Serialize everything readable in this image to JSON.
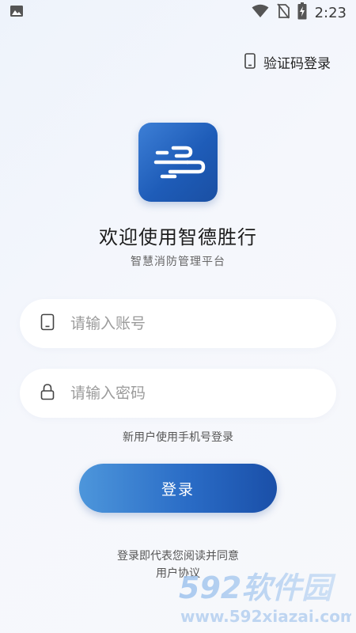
{
  "status_bar": {
    "time": "2:23",
    "icons": [
      "image-icon",
      "wifi-icon",
      "no-sim-icon",
      "battery-charging-icon"
    ]
  },
  "header": {
    "verify_login_label": "验证码登录",
    "verify_login_icon": "phone-icon"
  },
  "app": {
    "title": "欢迎使用智德胜行",
    "subtitle": "智慧消防管理平台",
    "logo_icon": "app-logo-icon",
    "brand_color": "#2a6cc6"
  },
  "form": {
    "account_placeholder": "请输入账号",
    "account_icon": "phone-icon",
    "password_placeholder": "请输入密码",
    "password_icon": "lock-icon",
    "new_user_link": "新用户使用手机号登录",
    "login_button": "登录"
  },
  "footer": {
    "agreement_line1": "登录即代表您阅读并同意",
    "agreement_line2": "用户协议"
  },
  "watermark": {
    "brand": "592软件园",
    "url": "www.592xiazai.com"
  }
}
